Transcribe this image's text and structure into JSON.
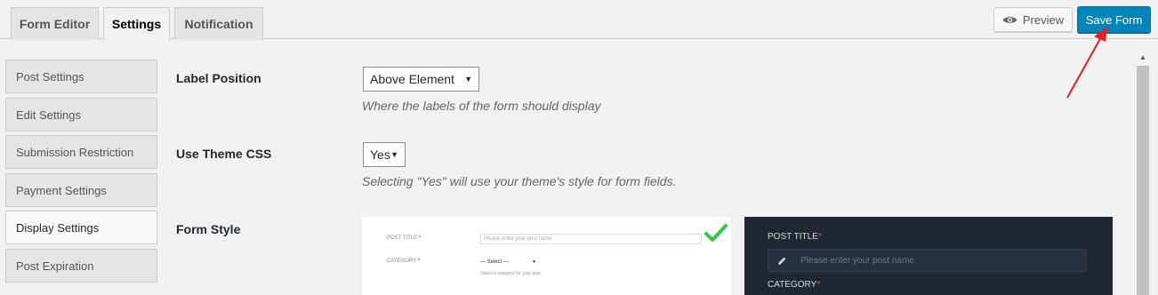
{
  "tabs": [
    {
      "label": "Form Editor",
      "active": false
    },
    {
      "label": "Settings",
      "active": true
    },
    {
      "label": "Notification",
      "active": false
    }
  ],
  "toolbar": {
    "preview_label": "Preview",
    "save_label": "Save Form"
  },
  "sidebar": {
    "items": [
      {
        "label": "Post Settings"
      },
      {
        "label": "Edit Settings"
      },
      {
        "label": "Submission Restriction"
      },
      {
        "label": "Payment Settings"
      },
      {
        "label": "Display Settings",
        "active": true
      },
      {
        "label": "Post Expiration"
      }
    ]
  },
  "settings": {
    "label_position": {
      "label": "Label Position",
      "value": "Above Element",
      "description": "Where the labels of the form should display"
    },
    "use_theme_css": {
      "label": "Use Theme CSS",
      "value": "Yes",
      "description": "Selecting \"Yes\" will use your theme's style for form fields."
    },
    "form_style": {
      "label": "Form Style"
    }
  },
  "preview_light": {
    "post_title_label": "POST TITLE",
    "post_title_placeholder": "Please enter your post name",
    "category_label": "CATEGORY",
    "category_select": "— Select —",
    "category_help": "Select a category for your post",
    "required_mark": "*"
  },
  "preview_dark": {
    "post_title_label": "POST TITLE",
    "post_title_placeholder": "Please enter your post name",
    "category_label": "CATEGORY",
    "required_mark": "*"
  },
  "colors": {
    "accent": "#0085ba",
    "annotation_arrow": "#e31e24",
    "check": "#2ecc40",
    "dark_preview_bg": "#1e2732"
  }
}
